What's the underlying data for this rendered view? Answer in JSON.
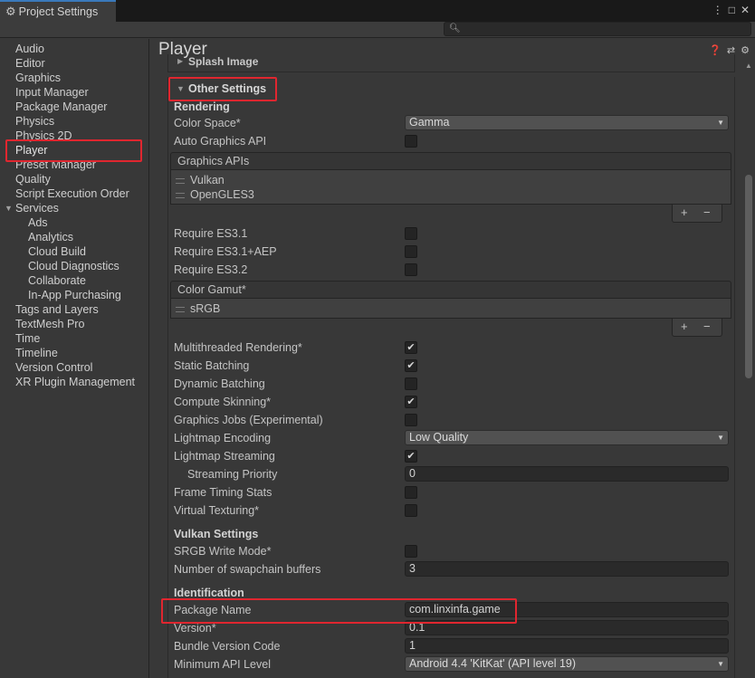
{
  "window": {
    "tab_title": "Project Settings",
    "tab_icon": "gear-icon",
    "controls": [
      "⋮",
      "□",
      "✕"
    ]
  },
  "search": {
    "placeholder": "",
    "icon": "search-icon"
  },
  "sidebar": {
    "items": [
      {
        "label": "Audio"
      },
      {
        "label": "Editor"
      },
      {
        "label": "Graphics"
      },
      {
        "label": "Input Manager"
      },
      {
        "label": "Package Manager"
      },
      {
        "label": "Physics"
      },
      {
        "label": "Physics 2D"
      },
      {
        "label": "Player",
        "selected": true
      },
      {
        "label": "Preset Manager"
      },
      {
        "label": "Quality"
      },
      {
        "label": "Script Execution Order"
      },
      {
        "label": "Services",
        "expanded": true
      },
      {
        "label": "Ads",
        "sub": true
      },
      {
        "label": "Analytics",
        "sub": true
      },
      {
        "label": "Cloud Build",
        "sub": true
      },
      {
        "label": "Cloud Diagnostics",
        "sub": true
      },
      {
        "label": "Collaborate",
        "sub": true
      },
      {
        "label": "In-App Purchasing",
        "sub": true
      },
      {
        "label": "Tags and Layers"
      },
      {
        "label": "TextMesh Pro"
      },
      {
        "label": "Time"
      },
      {
        "label": "Timeline"
      },
      {
        "label": "Version Control"
      },
      {
        "label": "XR Plugin Management"
      }
    ]
  },
  "main": {
    "title": "Player",
    "header_icons": [
      "help-icon",
      "presets-icon",
      "settings-icon"
    ],
    "splash_label": "Splash Image",
    "section_title": "Other Settings",
    "rendering": {
      "header": "Rendering",
      "color_space_label": "Color Space*",
      "color_space_value": "Gamma",
      "auto_graphics_api_label": "Auto Graphics API",
      "auto_graphics_api": false,
      "graphics_apis_header": "Graphics APIs",
      "graphics_apis": [
        "Vulkan",
        "OpenGLES3"
      ],
      "require_es31_label": "Require ES3.1",
      "require_es31": false,
      "require_es31aep_label": "Require ES3.1+AEP",
      "require_es31aep": false,
      "require_es32_label": "Require ES3.2",
      "require_es32": false,
      "color_gamut_header": "Color Gamut*",
      "color_gamut": [
        "sRGB"
      ],
      "list_add": "+",
      "list_remove": "−",
      "multithreaded_label": "Multithreaded Rendering*",
      "multithreaded": true,
      "static_batching_label": "Static Batching",
      "static_batching": true,
      "dynamic_batching_label": "Dynamic Batching",
      "dynamic_batching": false,
      "compute_skinning_label": "Compute Skinning*",
      "compute_skinning": true,
      "graphics_jobs_label": "Graphics Jobs (Experimental)",
      "graphics_jobs": false,
      "lightmap_encoding_label": "Lightmap Encoding",
      "lightmap_encoding_value": "Low Quality",
      "lightmap_streaming_label": "Lightmap Streaming",
      "lightmap_streaming": true,
      "streaming_priority_label": "Streaming Priority",
      "streaming_priority_value": "0",
      "frame_timing_label": "Frame Timing Stats",
      "frame_timing": false,
      "virtual_texturing_label": "Virtual Texturing*",
      "virtual_texturing": false
    },
    "vulkan": {
      "header": "Vulkan Settings",
      "srgb_write_label": "SRGB Write Mode*",
      "srgb_write": false,
      "swapchain_label": "Number of swapchain buffers",
      "swapchain_value": "3"
    },
    "identification": {
      "header": "Identification",
      "package_name_label": "Package Name",
      "package_name_value": "com.linxinfa.game",
      "version_label": "Version*",
      "version_value": "0.1",
      "bundle_code_label": "Bundle Version Code",
      "bundle_code_value": "1",
      "min_api_label": "Minimum API Level",
      "min_api_value": "Android 4.4 'KitKat' (API level 19)"
    }
  },
  "colors": {
    "highlight_box": "#e0262f",
    "accent": "#3a79bb",
    "background": "#383838"
  }
}
